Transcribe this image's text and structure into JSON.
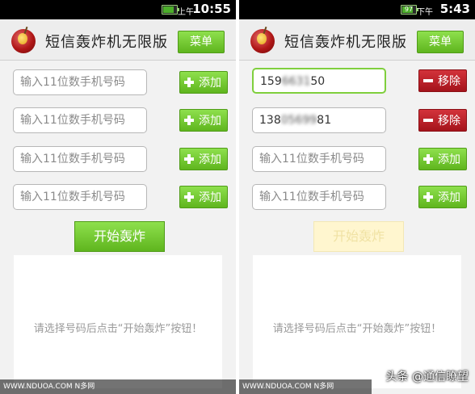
{
  "status_left": {
    "ampm": "上午",
    "time": "10:55"
  },
  "status_right": {
    "battery": "97",
    "ampm": "下午",
    "time": "5:43"
  },
  "app": {
    "title": "短信轰炸机无限版",
    "menu_label": "菜单"
  },
  "phone_placeholder": "输入11位数手机号码",
  "add_label": "添加",
  "remove_label": "移除",
  "right_numbers": [
    {
      "prefix": "159",
      "hidden": "6631",
      "suffix": "50"
    },
    {
      "prefix": "138",
      "hidden": "05699",
      "suffix": "81"
    }
  ],
  "start_label": "开始轰炸",
  "message": "请选择号码后点击“开始轰炸”按钮！",
  "watermark": "WWW.NDUOA.COM N多网",
  "source_tag": "头条 @通信瞭望",
  "colors": {
    "accent_green": "#6cc32a",
    "remove_red": "#b5161e"
  },
  "icons": {
    "add": "plus-icon",
    "remove": "minus-icon"
  }
}
